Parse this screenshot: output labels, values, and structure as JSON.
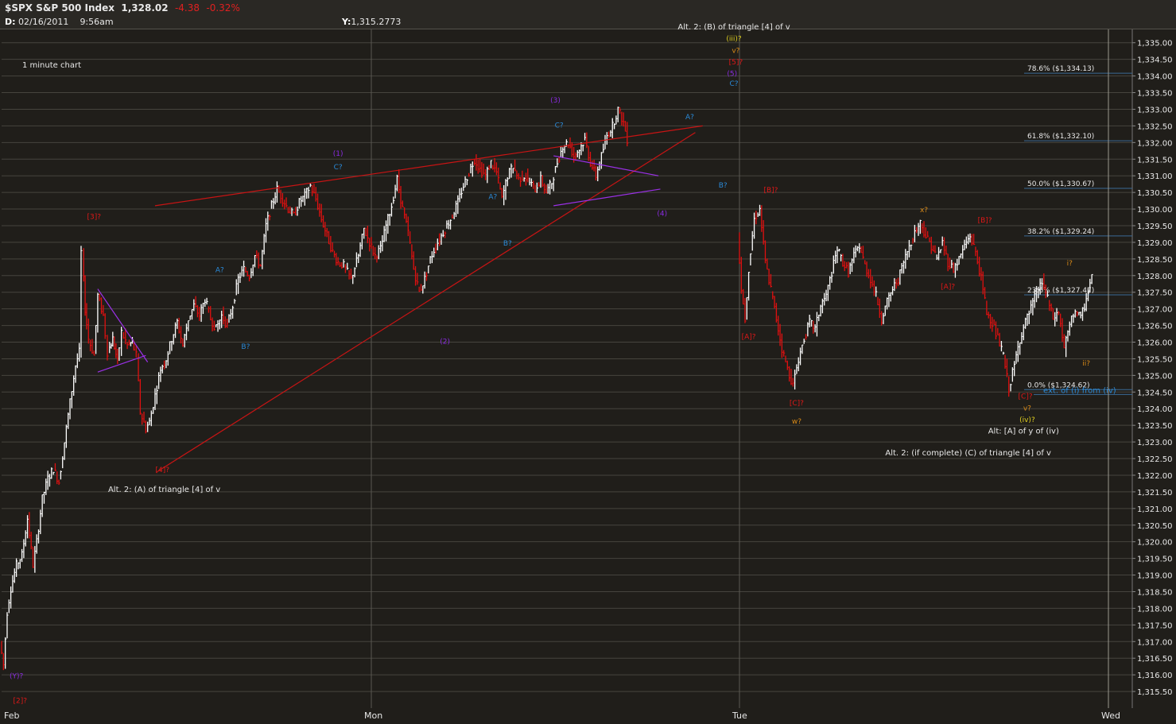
{
  "header": {
    "symbol": "$SPX",
    "name": "S&P 500 Index",
    "last": "1,328.02",
    "change": "-4.38",
    "change_pct": "-0.32%",
    "date_label": "D:",
    "date": "02/16/2011",
    "time": "9:56am",
    "y_label": "Y:",
    "y_value": "1,315.2773"
  },
  "colors": {
    "background": "#201e1a",
    "grid": "#46443e",
    "up": "#ffffff",
    "down": "#e01010",
    "red_label": "#e01818",
    "purple": "#8a2be2",
    "blue": "#2a8ad8",
    "orange": "#d88a18",
    "yellow": "#e0d020",
    "text": "#e8e8e8"
  },
  "chart_data": {
    "type": "line",
    "title": "1 minute chart",
    "xlabel": "",
    "ylabel": "",
    "ylim": [
      1315.0,
      1335.4
    ],
    "y_ticks": [
      "1,315.50",
      "1,316.00",
      "1,316.50",
      "1,317.00",
      "1,317.50",
      "1,318.00",
      "1,318.50",
      "1,319.00",
      "1,319.50",
      "1,320.00",
      "1,320.50",
      "1,321.00",
      "1,321.50",
      "1,322.00",
      "1,322.50",
      "1,323.00",
      "1,323.50",
      "1,324.00",
      "1,324.50",
      "1,325.00",
      "1,325.50",
      "1,326.00",
      "1,326.50",
      "1,327.00",
      "1,327.50",
      "1,328.00",
      "1,328.50",
      "1,329.00",
      "1,329.50",
      "1,330.00",
      "1,330.50",
      "1,331.00",
      "1,331.50",
      "1,332.00",
      "1,332.50",
      "1,333.00",
      "1,333.50",
      "1,334.00",
      "1,334.50",
      "1,335.00"
    ],
    "x_labels": [
      {
        "label": "Feb",
        "session": 0
      },
      {
        "label": "Mon",
        "session": 1
      },
      {
        "label": "Tue",
        "session": 2
      },
      {
        "label": "Wed",
        "session": 3
      }
    ],
    "series": [
      {
        "points": [
          [
            0.0,
            1317.0
          ],
          [
            0.01,
            1316.3
          ],
          [
            0.02,
            1317.9
          ],
          [
            0.03,
            1318.6
          ],
          [
            0.045,
            1319.3
          ],
          [
            0.06,
            1319.6
          ],
          [
            0.075,
            1320.7
          ],
          [
            0.09,
            1319.3
          ],
          [
            0.1,
            1320.0
          ],
          [
            0.115,
            1321.3
          ],
          [
            0.13,
            1321.9
          ],
          [
            0.145,
            1322.2
          ],
          [
            0.16,
            1321.8
          ],
          [
            0.175,
            1323.0
          ],
          [
            0.19,
            1324.2
          ],
          [
            0.205,
            1325.3
          ],
          [
            0.215,
            1325.7
          ],
          [
            0.222,
            1328.7
          ],
          [
            0.23,
            1327.0
          ],
          [
            0.24,
            1326.1
          ],
          [
            0.255,
            1325.6
          ],
          [
            0.265,
            1327.4
          ],
          [
            0.28,
            1326.8
          ],
          [
            0.292,
            1325.7
          ],
          [
            0.305,
            1326.1
          ],
          [
            0.318,
            1325.4
          ],
          [
            0.33,
            1326.3
          ],
          [
            0.345,
            1325.9
          ],
          [
            0.358,
            1326.0
          ],
          [
            0.37,
            1325.6
          ],
          [
            0.38,
            1323.9
          ],
          [
            0.395,
            1323.4
          ],
          [
            0.405,
            1323.6
          ],
          [
            0.42,
            1324.4
          ],
          [
            0.435,
            1325.2
          ],
          [
            0.45,
            1325.5
          ],
          [
            0.465,
            1326.1
          ],
          [
            0.48,
            1326.6
          ],
          [
            0.495,
            1325.9
          ],
          [
            0.51,
            1326.7
          ],
          [
            0.525,
            1327.1
          ],
          [
            0.54,
            1326.8
          ],
          [
            0.555,
            1327.3
          ],
          [
            0.57,
            1326.7
          ],
          [
            0.585,
            1326.4
          ],
          [
            0.6,
            1326.8
          ],
          [
            0.615,
            1326.5
          ],
          [
            0.63,
            1327.1
          ],
          [
            0.645,
            1327.9
          ],
          [
            0.66,
            1328.2
          ],
          [
            0.675,
            1328.0
          ],
          [
            0.69,
            1328.6
          ],
          [
            0.705,
            1328.3
          ],
          [
            0.72,
            1329.5
          ],
          [
            0.735,
            1330.1
          ],
          [
            0.75,
            1330.6
          ],
          [
            0.765,
            1330.3
          ],
          [
            0.78,
            1330.0
          ],
          [
            0.795,
            1329.8
          ],
          [
            0.81,
            1330.2
          ],
          [
            0.825,
            1330.4
          ],
          [
            0.84,
            1330.7
          ],
          [
            0.855,
            1330.3
          ],
          [
            0.87,
            1329.7
          ],
          [
            0.885,
            1329.2
          ],
          [
            0.9,
            1328.7
          ],
          [
            0.915,
            1328.4
          ],
          [
            0.93,
            1328.3
          ],
          [
            0.95,
            1327.9
          ],
          [
            0.97,
            1328.6
          ],
          [
            0.985,
            1329.4
          ],
          [
            1.0,
            1329.0
          ],
          [
            1.015,
            1328.6
          ],
          [
            1.03,
            1328.8
          ],
          [
            1.045,
            1329.5
          ],
          [
            1.06,
            1330.1
          ],
          [
            1.075,
            1330.9
          ],
          [
            1.09,
            1330.0
          ],
          [
            1.105,
            1329.3
          ],
          [
            1.12,
            1328.2
          ],
          [
            1.135,
            1327.5
          ],
          [
            1.15,
            1327.9
          ],
          [
            1.165,
            1328.5
          ],
          [
            1.18,
            1328.9
          ],
          [
            1.195,
            1329.2
          ],
          [
            1.21,
            1329.5
          ],
          [
            1.225,
            1329.8
          ],
          [
            1.24,
            1330.2
          ],
          [
            1.255,
            1330.7
          ],
          [
            1.27,
            1331.1
          ],
          [
            1.285,
            1331.5
          ],
          [
            1.3,
            1331.2
          ],
          [
            1.315,
            1331.0
          ],
          [
            1.33,
            1331.4
          ],
          [
            1.345,
            1331.1
          ],
          [
            1.36,
            1330.3
          ],
          [
            1.375,
            1331.0
          ],
          [
            1.39,
            1331.3
          ],
          [
            1.405,
            1330.9
          ],
          [
            1.42,
            1331.0
          ],
          [
            1.435,
            1330.8
          ],
          [
            1.45,
            1330.6
          ],
          [
            1.465,
            1330.9
          ],
          [
            1.48,
            1330.5
          ],
          [
            1.495,
            1330.8
          ],
          [
            1.51,
            1331.4
          ],
          [
            1.525,
            1331.9
          ],
          [
            1.54,
            1332.0
          ],
          [
            1.555,
            1331.6
          ],
          [
            1.57,
            1331.8
          ],
          [
            1.585,
            1332.1
          ],
          [
            1.6,
            1331.4
          ],
          [
            1.615,
            1331.0
          ],
          [
            1.63,
            1331.6
          ],
          [
            1.645,
            1332.2
          ],
          [
            1.66,
            1332.5
          ],
          [
            1.675,
            1333.0
          ],
          [
            1.69,
            1332.6
          ],
          [
            1.7,
            1332.1
          ],
          [
            2.0,
            1329.3
          ],
          [
            2.01,
            1327.6
          ],
          [
            2.02,
            1326.7
          ],
          [
            2.03,
            1328.2
          ],
          [
            2.045,
            1329.7
          ],
          [
            2.06,
            1330.0
          ],
          [
            2.075,
            1328.4
          ],
          [
            2.09,
            1327.6
          ],
          [
            2.105,
            1326.7
          ],
          [
            2.12,
            1325.8
          ],
          [
            2.135,
            1325.2
          ],
          [
            2.15,
            1324.7
          ],
          [
            2.165,
            1325.5
          ],
          [
            2.18,
            1326.1
          ],
          [
            2.195,
            1326.6
          ],
          [
            2.21,
            1326.4
          ],
          [
            2.225,
            1327.1
          ],
          [
            2.24,
            1327.4
          ],
          [
            2.255,
            1328.1
          ],
          [
            2.27,
            1328.8
          ],
          [
            2.285,
            1328.4
          ],
          [
            2.3,
            1328.1
          ],
          [
            2.315,
            1328.6
          ],
          [
            2.33,
            1328.9
          ],
          [
            2.345,
            1328.3
          ],
          [
            2.36,
            1327.9
          ],
          [
            2.375,
            1327.4
          ],
          [
            2.39,
            1326.7
          ],
          [
            2.405,
            1327.2
          ],
          [
            2.42,
            1327.6
          ],
          [
            2.435,
            1327.9
          ],
          [
            2.45,
            1328.4
          ],
          [
            2.465,
            1328.9
          ],
          [
            2.48,
            1329.3
          ],
          [
            2.495,
            1329.6
          ],
          [
            2.51,
            1329.2
          ],
          [
            2.525,
            1328.9
          ],
          [
            2.54,
            1328.5
          ],
          [
            2.555,
            1329.0
          ],
          [
            2.57,
            1328.4
          ],
          [
            2.585,
            1328.2
          ],
          [
            2.6,
            1328.5
          ],
          [
            2.615,
            1328.9
          ],
          [
            2.63,
            1329.2
          ],
          [
            2.645,
            1328.7
          ],
          [
            2.66,
            1327.9
          ],
          [
            2.675,
            1326.9
          ],
          [
            2.69,
            1326.6
          ],
          [
            2.705,
            1326.1
          ],
          [
            2.72,
            1325.6
          ],
          [
            2.735,
            1324.6
          ],
          [
            2.75,
            1325.3
          ],
          [
            2.765,
            1326.1
          ],
          [
            2.78,
            1326.6
          ],
          [
            2.795,
            1327.0
          ],
          [
            2.81,
            1327.5
          ],
          [
            2.825,
            1327.8
          ],
          [
            2.84,
            1327.3
          ],
          [
            2.855,
            1326.7
          ],
          [
            2.87,
            1326.9
          ],
          [
            2.885,
            1325.8
          ],
          [
            2.9,
            1326.5
          ],
          [
            2.915,
            1327.0
          ],
          [
            2.93,
            1326.7
          ],
          [
            2.945,
            1327.3
          ],
          [
            2.96,
            1328.0
          ]
        ]
      }
    ]
  },
  "fib_levels": [
    {
      "label": "78.6%  ($1,334.13)",
      "value": 1334.13
    },
    {
      "label": "61.8%  ($1,332.10)",
      "value": 1332.1
    },
    {
      "label": "50.0%  ($1,330.67)",
      "value": 1330.67
    },
    {
      "label": "38.2%  ($1,329.24)",
      "value": 1329.24
    },
    {
      "label": "23.6%  ($1,327.47)",
      "value": 1327.47
    },
    {
      "label": "0.0%  ($1,324.62)",
      "value": 1324.62
    }
  ],
  "trendlines": [
    {
      "color": "red",
      "from": [
        0.415,
        1330.1
      ],
      "to": [
        1.9,
        1332.5
      ]
    },
    {
      "color": "red",
      "from": [
        0.42,
        1322.1
      ],
      "to": [
        1.88,
        1332.3
      ]
    },
    {
      "color": "purple",
      "from": [
        0.26,
        1327.6
      ],
      "to": [
        0.395,
        1325.4
      ]
    },
    {
      "color": "purple",
      "from": [
        0.26,
        1325.1
      ],
      "to": [
        0.39,
        1325.6
      ]
    },
    {
      "color": "purple",
      "from": [
        1.495,
        1331.6
      ],
      "to": [
        1.78,
        1331.0
      ]
    },
    {
      "color": "purple",
      "from": [
        1.495,
        1330.1
      ],
      "to": [
        1.785,
        1330.6
      ]
    }
  ],
  "wave_labels": [
    {
      "text": "(Y)?",
      "s": 0.04,
      "v": 1315.9,
      "color": "purple"
    },
    {
      "text": "[2]?",
      "s": 0.05,
      "v": 1315.15,
      "color": "red"
    },
    {
      "text": "[3]?",
      "s": 0.25,
      "v": 1329.7,
      "color": "red"
    },
    {
      "text": "A?",
      "s": 0.59,
      "v": 1328.1,
      "color": "blue"
    },
    {
      "text": "B?",
      "s": 0.66,
      "v": 1325.8,
      "color": "blue"
    },
    {
      "text": "[4]?",
      "s": 0.435,
      "v": 1322.1,
      "color": "red"
    },
    {
      "text": "(1)",
      "s": 0.91,
      "v": 1331.6,
      "color": "purple"
    },
    {
      "text": "C?",
      "s": 0.91,
      "v": 1331.2,
      "color": "blue"
    },
    {
      "text": "(2)",
      "s": 1.2,
      "v": 1325.95,
      "color": "purple"
    },
    {
      "text": "A?",
      "s": 1.33,
      "v": 1330.3,
      "color": "blue"
    },
    {
      "text": "B?",
      "s": 1.37,
      "v": 1328.9,
      "color": "blue"
    },
    {
      "text": "(3)",
      "s": 1.5,
      "v": 1333.2,
      "color": "purple"
    },
    {
      "text": "C?",
      "s": 1.51,
      "v": 1332.45,
      "color": "blue"
    },
    {
      "text": "(4)",
      "s": 1.79,
      "v": 1329.8,
      "color": "purple"
    },
    {
      "text": "A?",
      "s": 1.865,
      "v": 1332.7,
      "color": "blue"
    },
    {
      "text": "B?",
      "s": 1.955,
      "v": 1330.65,
      "color": "blue"
    },
    {
      "text": "(5)",
      "s": 1.98,
      "v": 1334.0,
      "color": "purple"
    },
    {
      "text": "C?",
      "s": 1.985,
      "v": 1333.7,
      "color": "blue"
    },
    {
      "text": "[5]?",
      "s": 1.99,
      "v": 1334.35,
      "color": "red"
    },
    {
      "text": "v?",
      "s": 1.99,
      "v": 1334.7,
      "color": "orange"
    },
    {
      "text": "(iii)?",
      "s": 1.985,
      "v": 1335.05,
      "color": "yellow"
    },
    {
      "text": "[B]?",
      "s": 2.085,
      "v": 1330.5,
      "color": "red"
    },
    {
      "text": "[A]?",
      "s": 2.025,
      "v": 1326.1,
      "color": "red"
    },
    {
      "text": "[C]?",
      "s": 2.155,
      "v": 1324.1,
      "color": "red"
    },
    {
      "text": "w?",
      "s": 2.155,
      "v": 1323.55,
      "color": "orange"
    },
    {
      "text": "x?",
      "s": 2.5,
      "v": 1329.9,
      "color": "orange"
    },
    {
      "text": "[A]?",
      "s": 2.565,
      "v": 1327.6,
      "color": "red"
    },
    {
      "text": "[B]?",
      "s": 2.665,
      "v": 1329.6,
      "color": "red"
    },
    {
      "text": "i?",
      "s": 2.895,
      "v": 1328.3,
      "color": "orange"
    },
    {
      "text": "ii?",
      "s": 2.94,
      "v": 1325.3,
      "color": "orange"
    },
    {
      "text": "[C]?",
      "s": 2.775,
      "v": 1324.3,
      "color": "red"
    },
    {
      "text": "v?",
      "s": 2.78,
      "v": 1323.95,
      "color": "orange"
    },
    {
      "text": "(iv)?",
      "s": 2.78,
      "v": 1323.6,
      "color": "yellow"
    }
  ],
  "annotations": [
    {
      "text": "Alt. 2: (B) of triangle [4] of v",
      "s": 1.985,
      "v": 1335.4
    },
    {
      "text": "Alt. 2: (A) of triangle [4] of v",
      "s": 0.44,
      "v": 1321.5
    },
    {
      "text": "Alt: [A] of y of (iv)",
      "s": 2.77,
      "v": 1323.25
    },
    {
      "text": "Alt. 2: (if complete) (C) of triangle [4] of v",
      "s": 2.62,
      "v": 1322.6
    }
  ],
  "extension_label": {
    "text": "ext. of (i) from (iv)",
    "value": 1324.45
  }
}
